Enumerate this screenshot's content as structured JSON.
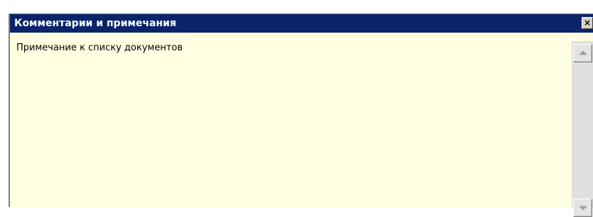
{
  "window": {
    "title": "Комментарии и примечания",
    "close_label": "×"
  },
  "content": {
    "text": "Примечание к списку документов"
  },
  "scrollbar": {
    "up_icon": "arrow-up-icon",
    "down_icon": "arrow-down-icon"
  },
  "colors": {
    "titlebar": "#0a246a",
    "background": "#ffffe1"
  }
}
